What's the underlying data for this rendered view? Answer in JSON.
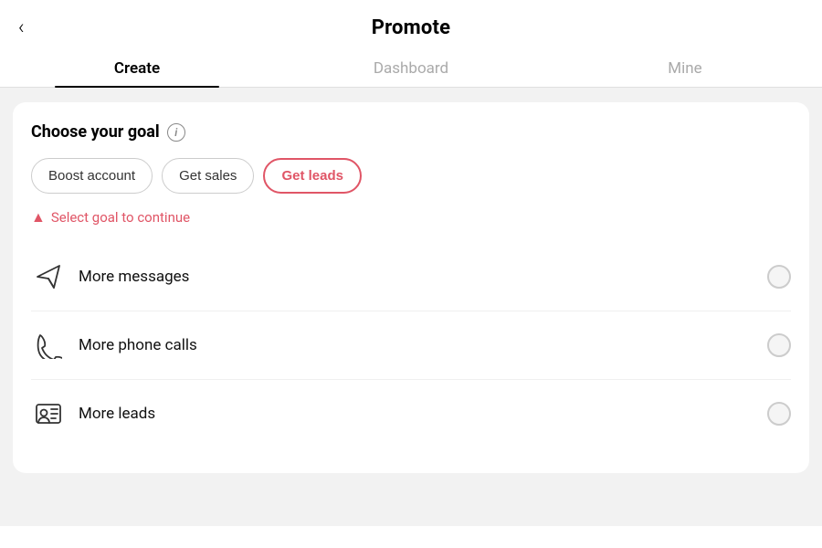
{
  "header": {
    "back_label": "‹",
    "title": "Promote"
  },
  "tabs": [
    {
      "id": "create",
      "label": "Create",
      "active": true
    },
    {
      "id": "dashboard",
      "label": "Dashboard",
      "active": false
    },
    {
      "id": "mine",
      "label": "Mine",
      "active": false
    }
  ],
  "card": {
    "goal_title": "Choose your goal",
    "info_icon_label": "i",
    "goal_buttons": [
      {
        "id": "boost-account",
        "label": "Boost account",
        "active": false
      },
      {
        "id": "get-sales",
        "label": "Get sales",
        "active": false
      },
      {
        "id": "get-leads",
        "label": "Get leads",
        "active": true
      }
    ],
    "warning_text": "Select goal to continue",
    "options": [
      {
        "id": "more-messages",
        "label": "More messages",
        "icon": "messages"
      },
      {
        "id": "more-phone-calls",
        "label": "More phone calls",
        "icon": "phone"
      },
      {
        "id": "more-leads",
        "label": "More leads",
        "icon": "leads"
      }
    ]
  }
}
